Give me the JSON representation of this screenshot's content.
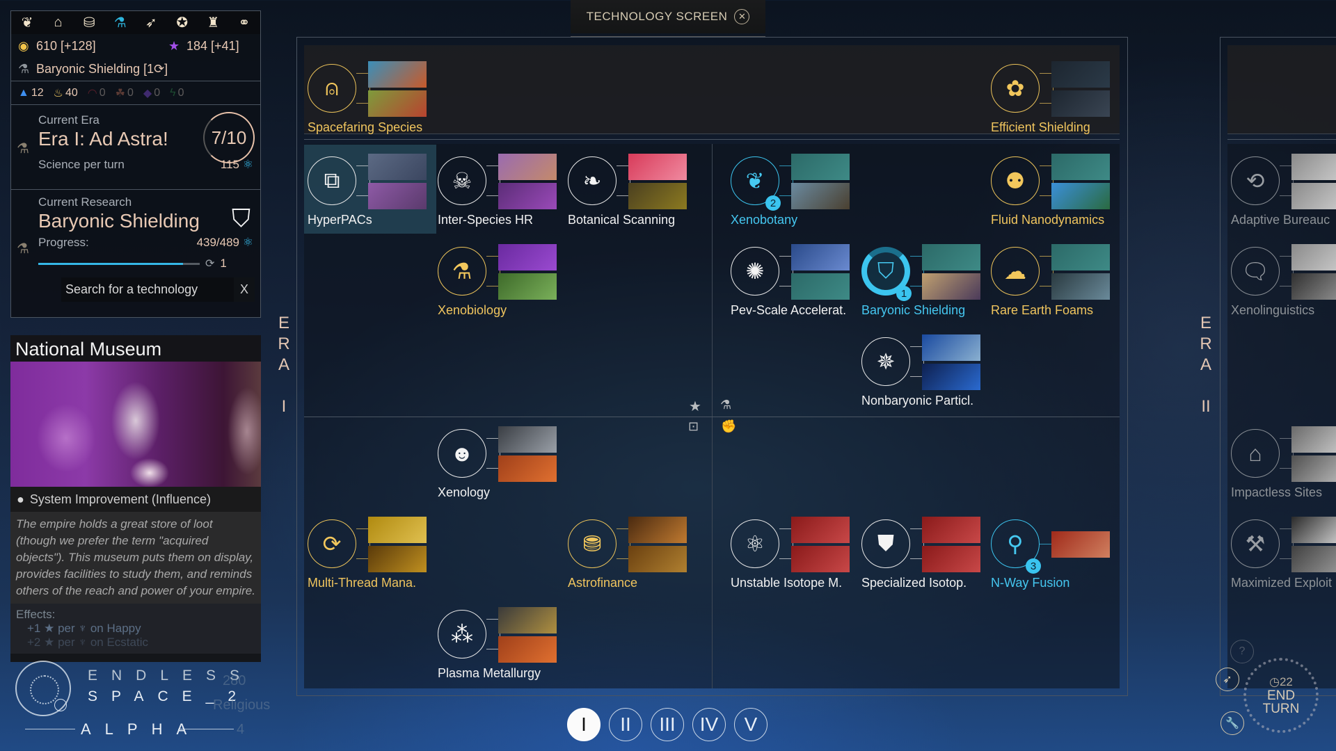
{
  "header": {
    "title": "TECHNOLOGY SCREEN",
    "close_icon": "close-circle-icon"
  },
  "top_nav": [
    {
      "icon": "laurel-icon",
      "glyph": "❦",
      "active": false
    },
    {
      "icon": "government-icon",
      "glyph": "🏛",
      "active": false
    },
    {
      "icon": "coins-icon",
      "glyph": "⛃",
      "active": false
    },
    {
      "icon": "flask-icon",
      "glyph": "⚗",
      "active": true
    },
    {
      "icon": "ship-icon",
      "glyph": "➚",
      "active": false
    },
    {
      "icon": "medal-icon",
      "glyph": "✪",
      "active": false
    },
    {
      "icon": "trophy-icon",
      "glyph": "♜",
      "active": false
    },
    {
      "icon": "handshake-icon",
      "glyph": "⚭",
      "active": false
    }
  ],
  "resources": {
    "dust": "610 [+128]",
    "influence": "184 [+41]",
    "current_research_line": "Baryonic Shielding [1⟳]"
  },
  "strategic_resources": [
    {
      "icon": "hyperium-icon",
      "value": "12",
      "color": "#3e8ff0"
    },
    {
      "icon": "fire-icon",
      "value": "40",
      "color": "#f0c860"
    },
    {
      "icon": "crescent-icon",
      "value": "0",
      "color": "#5a1f2a"
    },
    {
      "icon": "triquetra-icon",
      "value": "0",
      "color": "#5a3a34"
    },
    {
      "icon": "crystal-icon",
      "value": "0",
      "color": "#3f2a6e"
    },
    {
      "icon": "lightning-icon",
      "value": "0",
      "color": "#1c4a30"
    }
  ],
  "era": {
    "label": "Current Era",
    "title": "Era I: Ad Astra!",
    "progress": "7/10",
    "science_label": "Science per turn",
    "science_value": "115"
  },
  "research": {
    "label": "Current Research",
    "title": "Baryonic Shielding",
    "progress_label": "Progress:",
    "progress_value": "439/489",
    "progress_fraction": 0.898,
    "turns": "1",
    "search_placeholder": "Search for a technology",
    "search_clear": "X"
  },
  "tooltip": {
    "title": "National Museum",
    "type": "System Improvement (Influence)",
    "description": "The empire holds a great store of loot (though we prefer the term \"acquired objects\"). This museum puts them on display, provides facilities to study them, and reminds others of the reach and power of your empire.",
    "effects_label": "Effects:",
    "effects": [
      "+1 ★ per ♆ on Happy",
      "+2 ★ per ♆ on Ecstatic"
    ],
    "faded_values": [
      "280",
      "Religious",
      "4"
    ]
  },
  "logo": {
    "line1": "ENDLESS",
    "line2": "SPACE_2",
    "line3": "ALPHA"
  },
  "era_labels": {
    "era1": [
      "E",
      "R",
      "A",
      "",
      "I"
    ],
    "era2": [
      "E",
      "R",
      "A",
      "",
      "II"
    ]
  },
  "techs": [
    {
      "name": "Spacefaring Species",
      "state": "gold",
      "icon": "bell-icon",
      "glyph": "⍝",
      "badge": null
    },
    {
      "name": "Efficient Shielding",
      "state": "gold",
      "icon": "flower-syringe-icon",
      "glyph": "✿",
      "badge": null
    },
    {
      "name": "HyperPACs",
      "state": "white",
      "icon": "cube-arrows-icon",
      "glyph": "⧉",
      "badge": null,
      "selected": true
    },
    {
      "name": "Inter-Species HR",
      "state": "white",
      "icon": "alien-pyramid-icon",
      "glyph": "☠",
      "badge": null
    },
    {
      "name": "Botanical Scanning",
      "state": "white",
      "icon": "leaf-magnifier-icon",
      "glyph": "❧",
      "badge": null
    },
    {
      "name": "Xenobotany",
      "state": "blue",
      "icon": "tentacle-plant-icon",
      "glyph": "❦",
      "badge": "2"
    },
    {
      "name": "Fluid Nanodynamics",
      "state": "gold",
      "icon": "fluid-nodes-icon",
      "glyph": "⚉",
      "badge": null
    },
    {
      "name": "Xenobiology",
      "state": "gold",
      "icon": "flask-leaf-icon",
      "glyph": "⚗",
      "badge": null
    },
    {
      "name": "Pev-Scale Accelerat.",
      "state": "white",
      "icon": "accelerator-icon",
      "glyph": "✺",
      "badge": null
    },
    {
      "name": "Baryonic Shielding",
      "state": "blue",
      "icon": "shield-icon",
      "glyph": "⛉",
      "badge": "1",
      "active": true
    },
    {
      "name": "Rare Earth Foams",
      "state": "gold",
      "icon": "anvil-cloud-icon",
      "glyph": "☁",
      "badge": null
    },
    {
      "name": "Nonbaryonic Particl.",
      "state": "white",
      "icon": "molecule-icon",
      "glyph": "✵",
      "badge": null
    },
    {
      "name": "Xenology",
      "state": "white",
      "icon": "alien-head-icon",
      "glyph": "☻",
      "badge": null
    },
    {
      "name": "Multi-Thread Mana.",
      "state": "gold",
      "icon": "cycle-chip-icon",
      "glyph": "⟳",
      "badge": null
    },
    {
      "name": "Astrofinance",
      "state": "gold",
      "icon": "coin-stacks-icon",
      "glyph": "⛃",
      "badge": null
    },
    {
      "name": "Unstable Isotope M.",
      "state": "white",
      "icon": "atom-waves-icon",
      "glyph": "⚛",
      "badge": null
    },
    {
      "name": "Specialized Isotop.",
      "state": "white",
      "icon": "shell-shield-icon",
      "glyph": "⛊",
      "badge": null
    },
    {
      "name": "N-Way Fusion",
      "state": "blue",
      "icon": "fusion-node-icon",
      "glyph": "⚲",
      "badge": "3"
    },
    {
      "name": "Plasma Metallurgy",
      "state": "white",
      "icon": "plasma-anvil-icon",
      "glyph": "⁂",
      "badge": null
    },
    {
      "name": "Adaptive Bureauc",
      "state": "gray",
      "icon": "bureaucracy-icon",
      "glyph": "⟲",
      "badge": null
    },
    {
      "name": "Xenolinguistics",
      "state": "gray",
      "icon": "speech-alien-icon",
      "glyph": "🗨",
      "badge": null
    },
    {
      "name": "Impactless Sites",
      "state": "gray",
      "icon": "eco-factory-icon",
      "glyph": "⌂",
      "badge": null
    },
    {
      "name": "Maximized Exploit",
      "state": "gray",
      "icon": "pick-hammer-icon",
      "glyph": "⚒",
      "badge": null
    }
  ],
  "pager": [
    "I",
    "II",
    "III",
    "IV",
    "V"
  ],
  "pager_active": 0,
  "end_turn": {
    "turn": "22",
    "label": "END TURN"
  }
}
